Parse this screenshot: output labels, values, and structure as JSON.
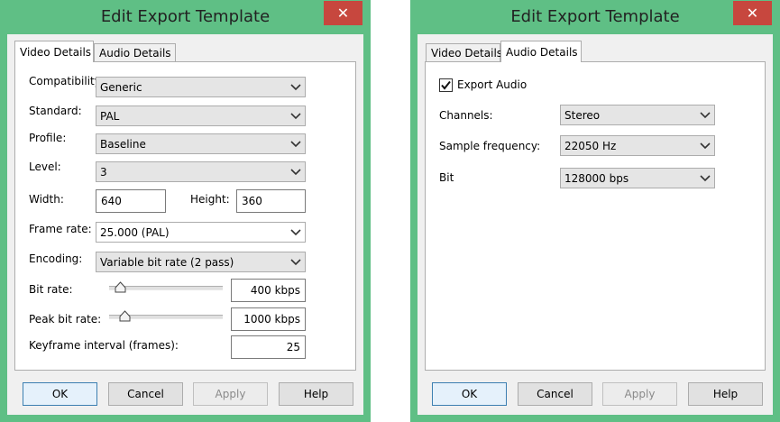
{
  "left": {
    "title": "Edit Export Template",
    "close": "✕",
    "tabs": [
      "Video Details",
      "Audio Details"
    ],
    "video": {
      "compatibility": {
        "label": "Compatibility",
        "value": "Generic"
      },
      "standard": {
        "label": "Standard:",
        "value": "PAL"
      },
      "profile": {
        "label": "Profile:",
        "value": "Baseline"
      },
      "level": {
        "label": "Level:",
        "value": "3"
      },
      "width": {
        "label": "Width:",
        "value": "640"
      },
      "height": {
        "label": "Height:",
        "value": "360"
      },
      "frame_rate": {
        "label": "Frame rate:",
        "value": "25.000 (PAL)"
      },
      "encoding": {
        "label": "Encoding:",
        "value": "Variable bit rate (2 pass)"
      },
      "bit_rate": {
        "label": "Bit rate:",
        "value": "400 kbps",
        "slider_fraction": 0.05
      },
      "peak_bit_rate": {
        "label": "Peak bit rate:",
        "value": "1000 kbps",
        "slider_fraction": 0.1
      },
      "keyframe": {
        "label": "Keyframe interval (frames):",
        "value": "25"
      }
    },
    "buttons": {
      "ok": "OK",
      "cancel": "Cancel",
      "apply": "Apply",
      "help": "Help"
    }
  },
  "right": {
    "title": "Edit Export Template",
    "close": "✕",
    "tabs": [
      "Video Details",
      "Audio Details"
    ],
    "audio": {
      "export_audio": {
        "label": "Export Audio",
        "checked": true
      },
      "channels": {
        "label": "Channels:",
        "value": "Stereo"
      },
      "sample_frequency": {
        "label": "Sample frequency:",
        "value": "22050 Hz"
      },
      "bit": {
        "label": "Bit",
        "value": "128000 bps"
      }
    },
    "buttons": {
      "ok": "OK",
      "cancel": "Cancel",
      "apply": "Apply",
      "help": "Help"
    }
  },
  "colors": {
    "window_frame": "#5fbf85",
    "close_button": "#c7473e",
    "client_bg": "#f0f0f0"
  },
  "icons": {
    "close": "close-icon",
    "dropdown": "chevron-down-icon",
    "slider_thumb": "slider-thumb-icon",
    "check": "checkmark-icon"
  }
}
